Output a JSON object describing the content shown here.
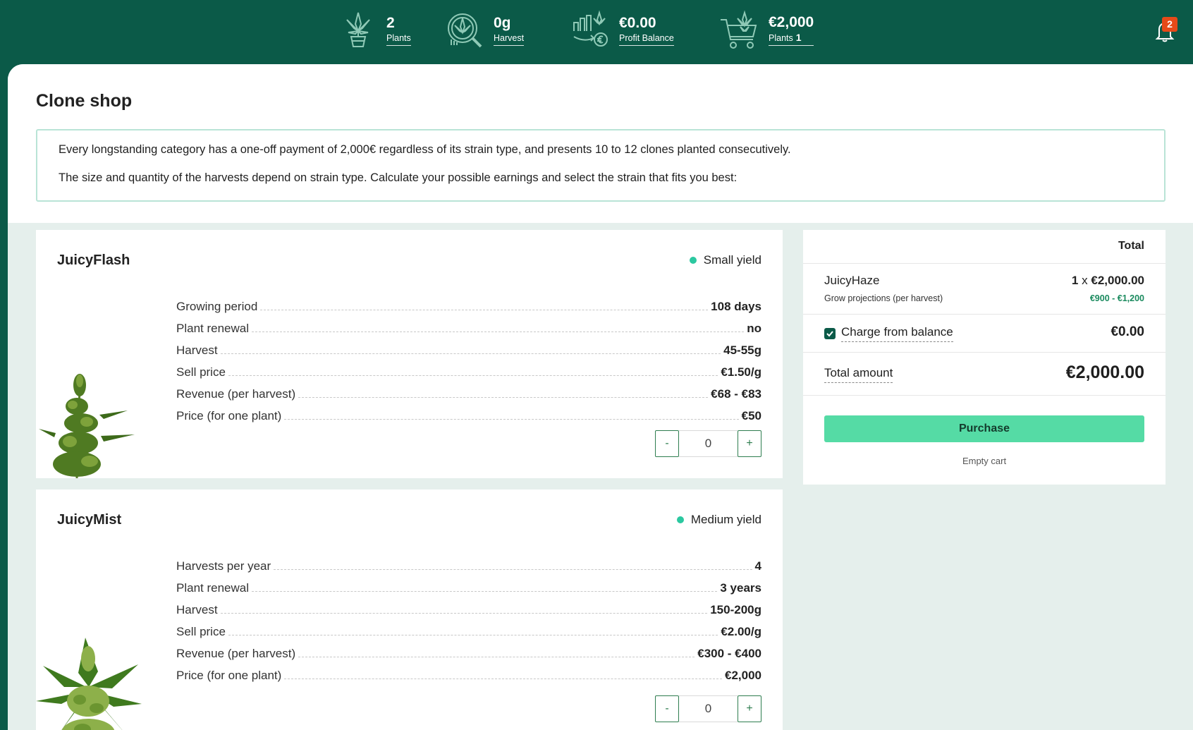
{
  "topbar": {
    "stats": [
      {
        "value": "2",
        "label": "Plants",
        "icon": "cannabis-pot-icon"
      },
      {
        "value": "0g",
        "label": "Harvest",
        "icon": "harvest-magnifier-icon"
      },
      {
        "value": "€0.00",
        "label": "Profit Balance",
        "icon": "profit-chart-icon"
      },
      {
        "value": "€2,000",
        "label": "Plants",
        "extra": "1",
        "icon": "plant-cart-icon"
      }
    ],
    "notifications": {
      "count": "2",
      "icon": "bell-icon"
    }
  },
  "page": {
    "title": "Clone shop",
    "info_line_1": "Every longstanding category has a one-off payment of 2,000€ regardless of its strain type, and presents 10 to 12 clones planted consecutively.",
    "info_line_2": "The size and quantity of the harvests depend on strain type. Calculate your possible earnings and select the strain that fits you best:"
  },
  "products": [
    {
      "name": "JuicyFlash",
      "yield": "Small yield",
      "specs": [
        {
          "label": "Growing period",
          "value": "108 days"
        },
        {
          "label": "Plant renewal",
          "value": "no"
        },
        {
          "label": "Harvest",
          "value": "45-55g"
        },
        {
          "label": "Sell price",
          "value": "€1.50/g"
        },
        {
          "label": "Revenue (per harvest)",
          "value": "€68 - €83"
        },
        {
          "label": "Price (for one plant)",
          "value": "€50"
        }
      ],
      "quantity": "0",
      "minus": "-",
      "plus": "+"
    },
    {
      "name": "JuicyMist",
      "yield": "Medium yield",
      "specs": [
        {
          "label": "Harvests per year",
          "value": "4"
        },
        {
          "label": "Plant renewal",
          "value": "3 years"
        },
        {
          "label": "Harvest",
          "value": "150-200g"
        },
        {
          "label": "Sell price",
          "value": "€2.00/g"
        },
        {
          "label": "Revenue (per harvest)",
          "value": "€300 - €400"
        },
        {
          "label": "Price (for one plant)",
          "value": "€2,000"
        }
      ],
      "quantity": "0",
      "minus": "-",
      "plus": "+"
    }
  ],
  "cart": {
    "total_header": "Total",
    "item": {
      "name": "JuicyHaze",
      "qty": "1",
      "times": "x",
      "price": "€2,000.00",
      "projection_label": "Grow projections (per harvest)",
      "projection": "€900 - €1,200"
    },
    "charge_label": "Charge from balance",
    "charge_checked": true,
    "charge_value": "€0.00",
    "amount_label": "Total amount",
    "amount_value": "€2,000.00",
    "purchase_label": "Purchase",
    "empty_label": "Empty cart"
  },
  "colors": {
    "brand": "#0b5a48",
    "accent": "#55dba5",
    "yield_dot": "#2bc8a0",
    "badge": "#e64a19"
  }
}
